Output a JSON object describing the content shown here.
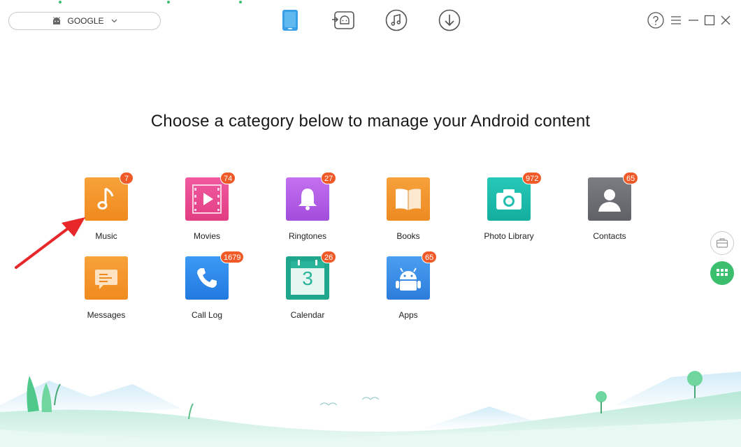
{
  "device": {
    "name": "GOOGLE"
  },
  "headline": "Choose a category below to manage your Android content",
  "categories": [
    {
      "key": "music",
      "label": "Music",
      "count": "7",
      "color": "#f5922a",
      "icon": "music-note-icon"
    },
    {
      "key": "movies",
      "label": "Movies",
      "count": "74",
      "color": "#ea4c8e",
      "icon": "film-play-icon"
    },
    {
      "key": "ringtones",
      "label": "Ringtones",
      "count": "27",
      "color": "#b05be6",
      "icon": "bell-icon"
    },
    {
      "key": "books",
      "label": "Books",
      "count": "",
      "color": "#f5922a",
      "icon": "book-icon"
    },
    {
      "key": "photo-library",
      "label": "Photo Library",
      "count": "972",
      "color": "#1fbfb0",
      "icon": "camera-icon"
    },
    {
      "key": "contacts",
      "label": "Contacts",
      "count": "65",
      "color": "#6d7075",
      "icon": "person-icon"
    },
    {
      "key": "messages",
      "label": "Messages",
      "count": "",
      "color": "#f5922a",
      "icon": "message-icon"
    },
    {
      "key": "call-log",
      "label": "Call Log",
      "count": "1679",
      "color": "#2f8cf0",
      "icon": "phone-icon"
    },
    {
      "key": "calendar",
      "label": "Calendar",
      "count": "26",
      "color": "#2ab59a",
      "icon": "calendar-icon",
      "day": "3"
    },
    {
      "key": "apps",
      "label": "Apps",
      "count": "65",
      "color": "#3a8de8",
      "icon": "android-robot-icon"
    }
  ],
  "colors": {
    "accent": "#3bbf6f",
    "badge": "#f05a28",
    "arrow": "#e8272a"
  }
}
